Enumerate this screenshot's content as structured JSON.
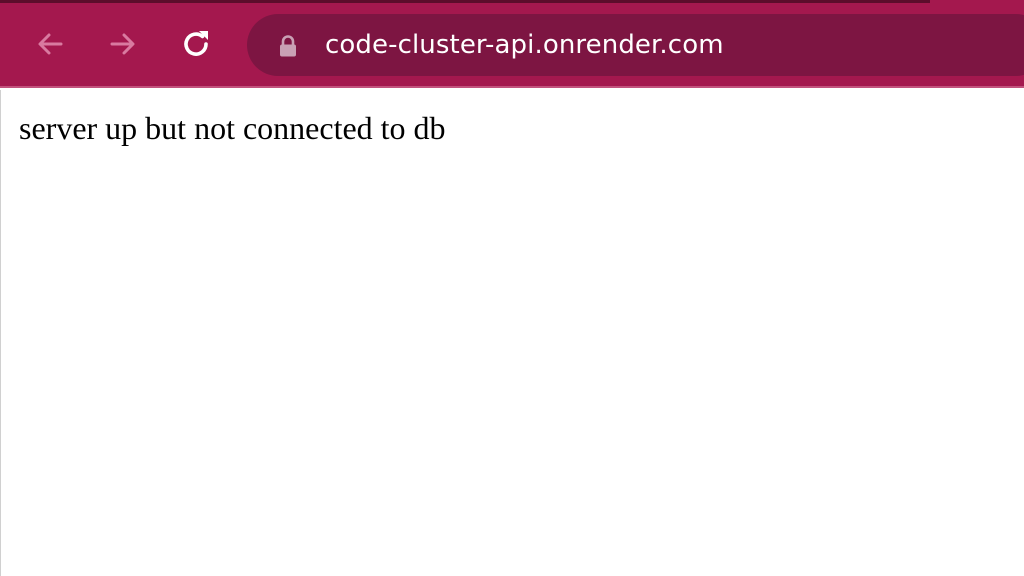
{
  "toolbar": {
    "back_icon": "arrow-left-icon",
    "forward_icon": "arrow-right-icon",
    "reload_icon": "reload-icon",
    "lock_icon": "lock-icon",
    "url": "code-cluster-api.onrender.com",
    "colors": {
      "toolbar_bg": "#a4184e",
      "omnibox_bg": "#7d1542",
      "url_text": "#ffffff"
    }
  },
  "page": {
    "text": "server up but not connected to db"
  }
}
